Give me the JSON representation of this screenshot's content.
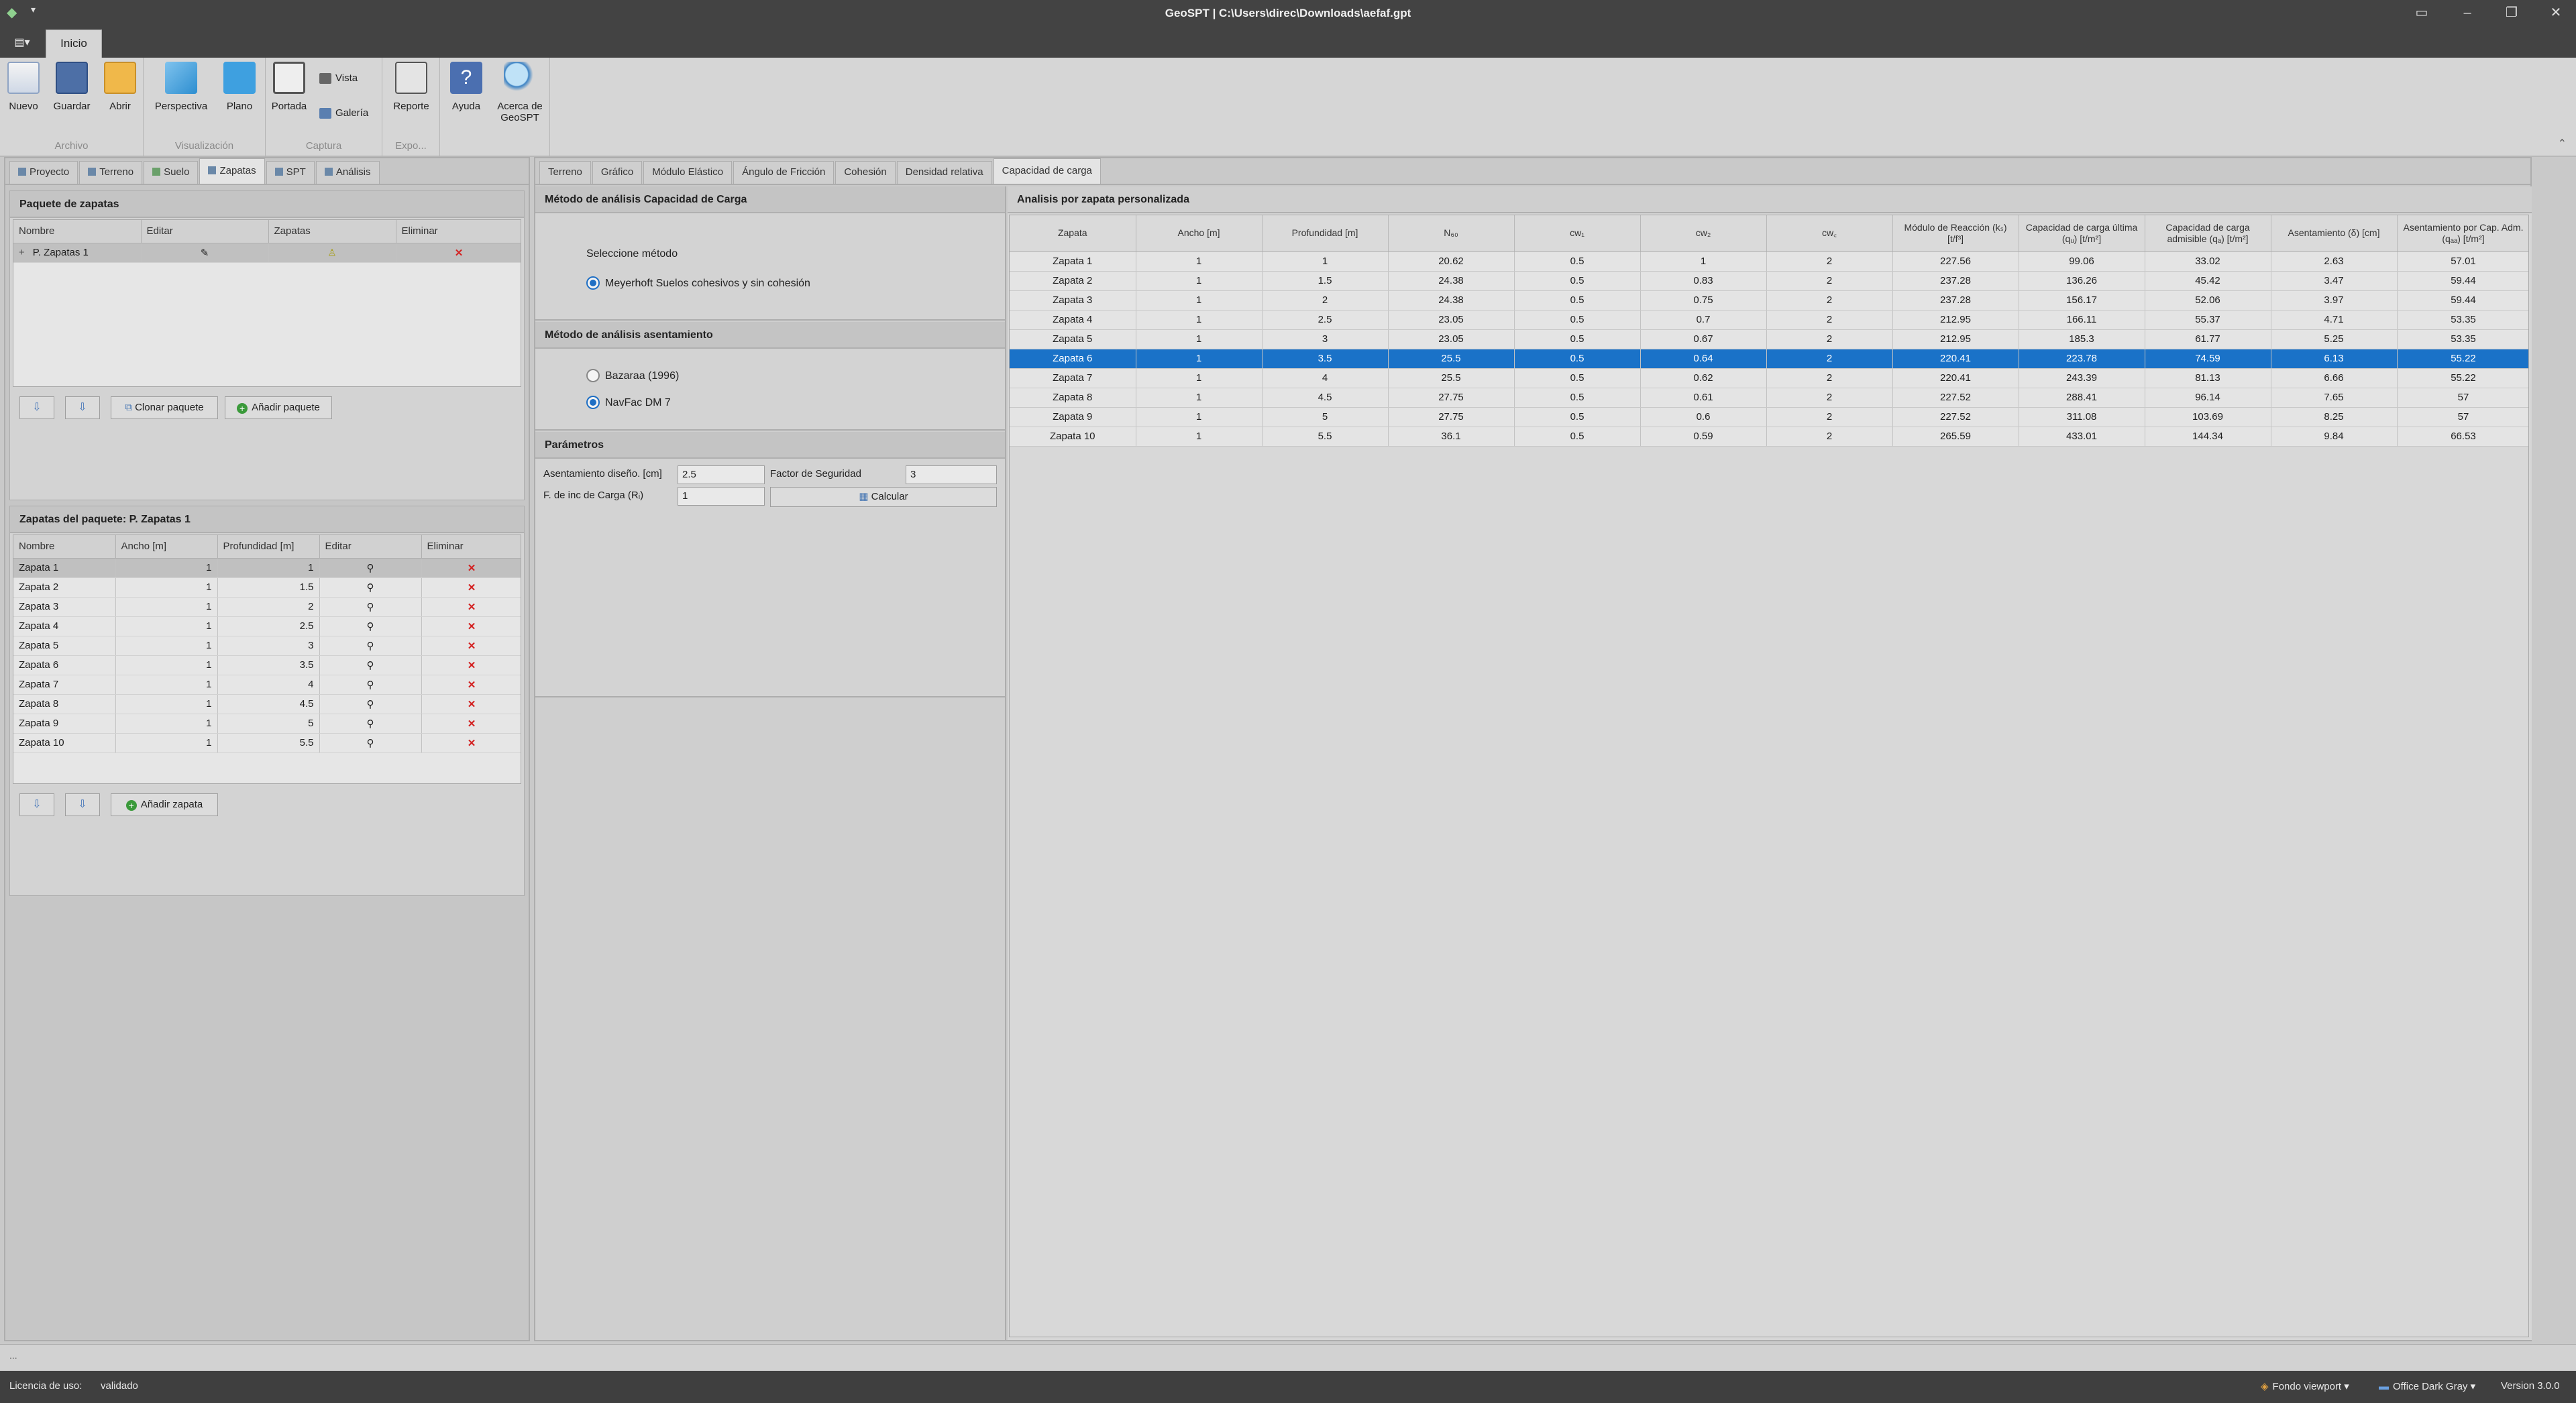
{
  "window": {
    "title": "GeoSPT  |  C:\\Users\\direc\\Downloads\\aefaf.gpt",
    "quick_access": "▾"
  },
  "ribbon": {
    "file_tab": "▤▾",
    "home_tab": "Inicio",
    "groups": {
      "archivo": "Archivo",
      "visualizacion": "Visualización",
      "captura": "Captura",
      "export": "Expo..."
    },
    "buttons": {
      "nuevo": "Nuevo",
      "guardar": "Guardar",
      "abrir": "Abrir",
      "perspectiva": "Perspectiva",
      "plano": "Plano",
      "portada": "Portada",
      "vista": "Vista",
      "galeria": "Galería",
      "reporte": "Reporte",
      "ayuda": "Ayuda",
      "acerca1": "Acerca de",
      "acerca2": "GeoSPT"
    }
  },
  "left": {
    "tabs": [
      "Proyecto",
      "Terreno",
      "Suelo",
      "Zapatas",
      "SPT",
      "Análisis"
    ],
    "paquete": {
      "header": "Paquete de zapatas",
      "columns": [
        "Nombre",
        "Editar",
        "Zapatas",
        "Eliminar"
      ],
      "rows": [
        {
          "expand": "+",
          "nombre": "P. Zapatas 1",
          "editar": "✎",
          "zapatas": "♙",
          "eliminar": "✕"
        }
      ],
      "clone_label": "Clonar paquete",
      "add_label": "Añadir paquete"
    },
    "zapatas": {
      "header": "Zapatas del paquete: P. Zapatas 1",
      "columns": [
        "Nombre",
        "Ancho [m]",
        "Profundidad [m]",
        "Editar",
        "Eliminar"
      ],
      "rows": [
        [
          "Zapata 1",
          "1",
          "1"
        ],
        [
          "Zapata 2",
          "1",
          "1.5"
        ],
        [
          "Zapata 3",
          "1",
          "2"
        ],
        [
          "Zapata 4",
          "1",
          "2.5"
        ],
        [
          "Zapata 5",
          "1",
          "3"
        ],
        [
          "Zapata 6",
          "1",
          "3.5"
        ],
        [
          "Zapata 7",
          "1",
          "4"
        ],
        [
          "Zapata 8",
          "1",
          "4.5"
        ],
        [
          "Zapata 9",
          "1",
          "5"
        ],
        [
          "Zapata 10",
          "1",
          "5.5"
        ]
      ],
      "edit_glyph": "⚲",
      "delete_glyph": "✕",
      "add_label": "Añadir zapata"
    }
  },
  "right": {
    "tabs": [
      "Terreno",
      "Gráfico",
      "Módulo Elástico",
      "Ángulo de Fricción",
      "Cohesión",
      "Densidad relativa",
      "Capacidad de carga"
    ],
    "capacidad": {
      "header": "Método de análisis Capacidad de Carga",
      "select_label": "Seleccione método",
      "option": "Meyerhoft Suelos cohesivos y sin cohesión"
    },
    "asentamiento": {
      "header": "Método de análisis asentamiento",
      "option1": "Bazaraa (1996)",
      "option2": "NavFac DM 7"
    },
    "parametros": {
      "header": "Parámetros",
      "asent_label": "Asentamiento diseño. [cm]",
      "asent_value": "2.5",
      "fs_label": "Factor de Seguridad",
      "fs_value": "3",
      "finc_label": "F. de inc de Carga (Rᵢ)",
      "finc_value": "1",
      "calcular": "Calcular"
    },
    "results": {
      "header": "Analisis por zapata personalizada",
      "columns": [
        "Zapata",
        "Ancho [m]",
        "Profundidad [m]",
        "N₆₀",
        "cw₁",
        "cw₂",
        "cw꜀",
        "Módulo de Reacción (kₛ) [t/f³]",
        "Capacidad de carga última (qᵤ) [t/m²]",
        "Capacidad de carga admisible (qₐ) [t/m²]",
        "Asentamiento (δ) [cm]",
        "Asentamiento por Cap. Adm. (qₐₐ) [t/m²]"
      ],
      "rows": [
        [
          "Zapata 1",
          "1",
          "1",
          "20.62",
          "0.5",
          "1",
          "2",
          "227.56",
          "99.06",
          "33.02",
          "2.63",
          "57.01"
        ],
        [
          "Zapata 2",
          "1",
          "1.5",
          "24.38",
          "0.5",
          "0.83",
          "2",
          "237.28",
          "136.26",
          "45.42",
          "3.47",
          "59.44"
        ],
        [
          "Zapata 3",
          "1",
          "2",
          "24.38",
          "0.5",
          "0.75",
          "2",
          "237.28",
          "156.17",
          "52.06",
          "3.97",
          "59.44"
        ],
        [
          "Zapata 4",
          "1",
          "2.5",
          "23.05",
          "0.5",
          "0.7",
          "2",
          "212.95",
          "166.11",
          "55.37",
          "4.71",
          "53.35"
        ],
        [
          "Zapata 5",
          "1",
          "3",
          "23.05",
          "0.5",
          "0.67",
          "2",
          "212.95",
          "185.3",
          "61.77",
          "5.25",
          "53.35"
        ],
        [
          "Zapata 6",
          "1",
          "3.5",
          "25.5",
          "0.5",
          "0.64",
          "2",
          "220.41",
          "223.78",
          "74.59",
          "6.13",
          "55.22"
        ],
        [
          "Zapata 7",
          "1",
          "4",
          "25.5",
          "0.5",
          "0.62",
          "2",
          "220.41",
          "243.39",
          "81.13",
          "6.66",
          "55.22"
        ],
        [
          "Zapata 8",
          "1",
          "4.5",
          "27.75",
          "0.5",
          "0.61",
          "2",
          "227.52",
          "288.41",
          "96.14",
          "7.65",
          "57"
        ],
        [
          "Zapata 9",
          "1",
          "5",
          "27.75",
          "0.5",
          "0.6",
          "2",
          "227.52",
          "311.08",
          "103.69",
          "8.25",
          "57"
        ],
        [
          "Zapata 10",
          "1",
          "5.5",
          "36.1",
          "0.5",
          "0.59",
          "2",
          "265.59",
          "433.01",
          "144.34",
          "9.84",
          "66.53"
        ]
      ],
      "selected_row": 5
    }
  },
  "status": {
    "license_label": "Licencia de uso:",
    "license_value": "validado",
    "viewport": "Fondo viewport ▾",
    "theme": "Office Dark Gray ▾",
    "version": "Version 3.0.0",
    "ellipsis": "..."
  },
  "colors": {
    "accent": "#1a72c8",
    "delete": "#d32020"
  }
}
